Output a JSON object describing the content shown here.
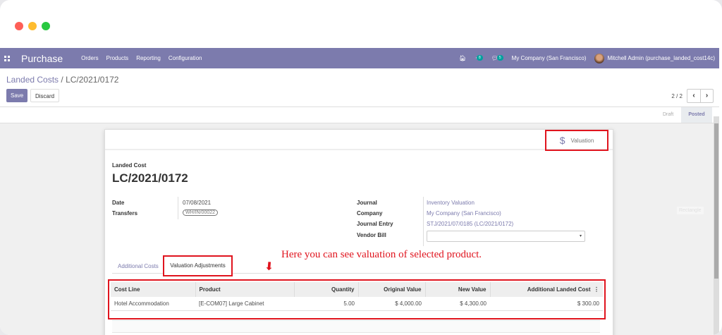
{
  "window": {
    "dot_colors": [
      "#fe5f57",
      "#febc2e",
      "#28c840"
    ]
  },
  "navbar": {
    "brand": "Purchase",
    "menu": [
      "Orders",
      "Products",
      "Reporting",
      "Configuration"
    ],
    "activity_count": "8",
    "messages_count": "5",
    "company": "My Company (San Francisco)",
    "user": "Mitchell Admin (purchase_landed_cost14c)",
    "color": "#7c7bad"
  },
  "breadcrumb": {
    "parent": "Landed Costs",
    "separator": " / ",
    "current": "LC/2021/0172"
  },
  "buttons": {
    "save": "Save",
    "discard": "Discard"
  },
  "pager": {
    "value": "2 / 2",
    "prev": "‹",
    "next": "›"
  },
  "status": {
    "draft": "Draft",
    "posted": "Posted"
  },
  "ghost": "Rectangle",
  "sheet": {
    "valuation_button": "Valuation",
    "label": "Landed Cost",
    "title": "LC/2021/0172",
    "fields_left": [
      {
        "label": "Date",
        "value": "07/08/2021"
      },
      {
        "label": "Transfers",
        "value": "WH/IN/00022"
      }
    ],
    "fields_right": [
      {
        "label": "Journal",
        "value": "Inventory Valuation"
      },
      {
        "label": "Company",
        "value": "My Company (San Francisco)"
      },
      {
        "label": "Journal Entry",
        "value": "STJ/2021/07/0185 (LC/2021/0172)"
      },
      {
        "label": "Vendor Bill",
        "value": ""
      }
    ],
    "tabs": [
      "Additional Costs",
      "Valuation Adjustments"
    ],
    "annotation": "Here you can see valuation of selected product.",
    "table": {
      "headers": [
        "Cost Line",
        "Product",
        "Quantity",
        "Original Value",
        "New Value",
        "Additional Landed Cost"
      ],
      "rows": [
        [
          "Hotel Accommodation",
          "[E-COM07] Large Cabinet",
          "5.00",
          "$ 4,000.00",
          "$ 4,300.00",
          "$ 300.00"
        ]
      ]
    }
  }
}
